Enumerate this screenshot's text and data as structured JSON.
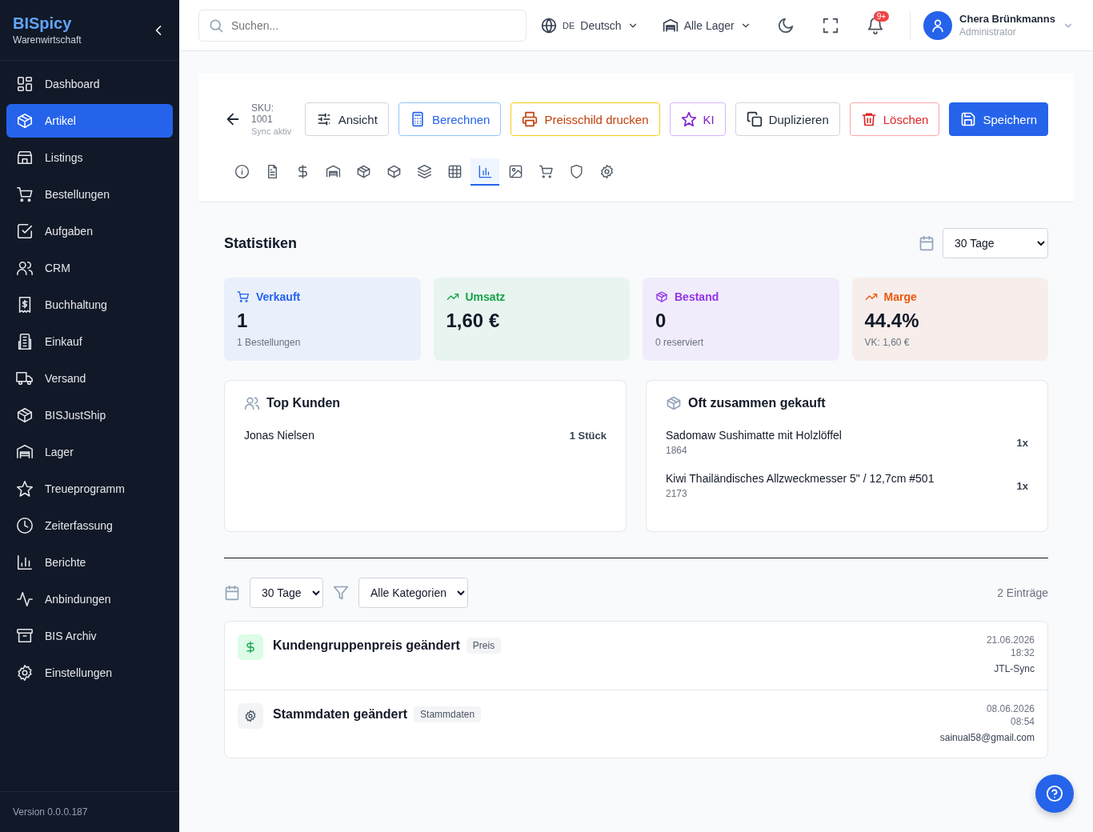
{
  "sidebar": {
    "brand": "BISpicy",
    "subtitle": "Warenwirtschaft",
    "items": [
      {
        "label": "Dashboard",
        "selected": false
      },
      {
        "label": "Artikel",
        "selected": true
      },
      {
        "label": "Listings",
        "selected": false
      },
      {
        "label": "Bestellungen",
        "selected": false
      },
      {
        "label": "Aufgaben",
        "selected": false
      },
      {
        "label": "CRM",
        "selected": false
      },
      {
        "label": "Buchhaltung",
        "selected": false
      },
      {
        "label": "Einkauf",
        "selected": false
      },
      {
        "label": "Versand",
        "selected": false
      },
      {
        "label": "BISJustShip",
        "selected": false
      },
      {
        "label": "Lager",
        "selected": false
      },
      {
        "label": "Treueprogramm",
        "selected": false
      },
      {
        "label": "Zeiterfassung",
        "selected": false
      },
      {
        "label": "Berichte",
        "selected": false
      },
      {
        "label": "Anbindungen",
        "selected": false
      },
      {
        "label": "BIS Archiv",
        "selected": false
      },
      {
        "label": "Einstellungen",
        "selected": false
      }
    ],
    "version": "Version 0.0.0.187"
  },
  "topbar": {
    "search": {
      "placeholder": "Suchen..."
    },
    "language": {
      "code": "DE",
      "label": "Deutsch"
    },
    "warehouse": "Alle Lager",
    "notification_badge": "9+",
    "user": {
      "name": "Chera Brünkmanns",
      "role": "Administrator"
    }
  },
  "header": {
    "sku_label": "SKU:",
    "sku": "1001",
    "sync": "Sync aktiv",
    "buttons": [
      {
        "label": "Ansicht",
        "kind": "view"
      },
      {
        "label": "Berechnen",
        "kind": "calc"
      },
      {
        "label": "Preisschild drucken",
        "kind": "print"
      },
      {
        "label": "KI",
        "kind": "ai"
      },
      {
        "label": "Duplizieren",
        "kind": "duplicate"
      },
      {
        "label": "Löschen",
        "kind": "delete"
      },
      {
        "label": "Speichern",
        "kind": "save"
      }
    ],
    "tabs": [
      {
        "selected": false
      },
      {
        "selected": false
      },
      {
        "selected": false
      },
      {
        "selected": false
      },
      {
        "selected": false
      },
      {
        "selected": false
      },
      {
        "selected": false
      },
      {
        "selected": false
      },
      {
        "selected": true
      },
      {
        "selected": false
      },
      {
        "selected": false
      },
      {
        "selected": false
      },
      {
        "selected": false
      }
    ]
  },
  "statistics": {
    "title": "Statistiken",
    "period": "30 Tage",
    "cards": [
      {
        "label": "Verkauft",
        "value": "1",
        "note": "1 Bestellungen",
        "color": "#2563eb"
      },
      {
        "label": "Umsatz",
        "value": "1,60 €",
        "color": "#16a34a"
      },
      {
        "label": "Bestand",
        "value": "0",
        "note": "0 reserviert",
        "color": "#9333ea"
      },
      {
        "label": "Marge",
        "value": "44.4%",
        "note": "VK: 1,60 €",
        "color": "#ea580c"
      }
    ],
    "top_customers": {
      "title": "Top Kunden",
      "rows": [
        {
          "name": "Jonas Nielsen",
          "quantity": "1 Stück"
        }
      ]
    },
    "bought_together": {
      "title": "Oft zusammen gekauft",
      "rows": [
        {
          "name": "Sadomaw Sushimatte mit Holzlöffel",
          "sku": "1864",
          "quantity": "1x"
        },
        {
          "name": "Kiwi Thailändisches Allzweckmesser 5\" / 12,7cm #501",
          "sku": "2173",
          "quantity": "1x"
        }
      ]
    }
  },
  "history": {
    "period": "30 Tage",
    "category": "Alle Kategorien",
    "count": "2 Einträge",
    "entries": [
      {
        "kind": "price",
        "title": "Kundengruppenpreis geändert",
        "tag": "Preis",
        "date": "21.06.2026",
        "time": "18:32",
        "author": "JTL-Sync"
      },
      {
        "kind": "master",
        "title": "Stammdaten geändert",
        "tag": "Stammdaten",
        "date": "08.06.2026",
        "time": "08:54",
        "author": "sainual58@gmail.com"
      }
    ]
  }
}
